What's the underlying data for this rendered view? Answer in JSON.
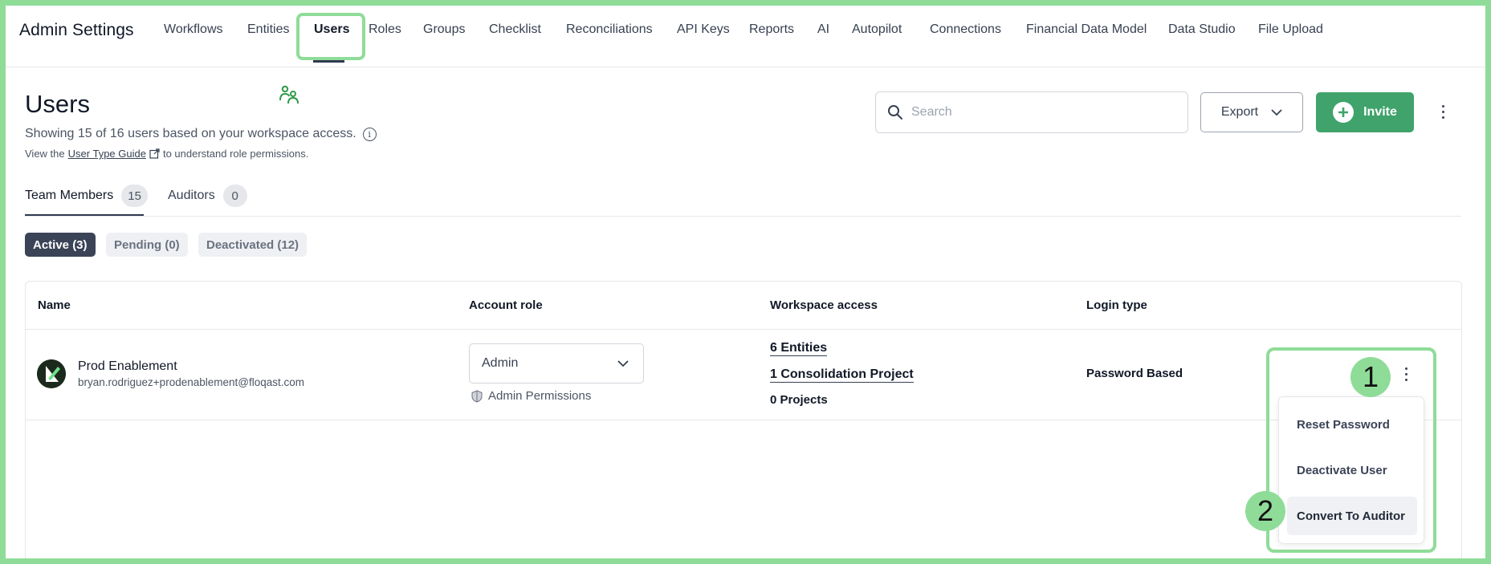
{
  "app": {
    "title": "Admin Settings"
  },
  "nav": {
    "tabs": [
      {
        "label": "Workflows"
      },
      {
        "label": "Entities"
      },
      {
        "label": "Users",
        "active": true
      },
      {
        "label": "Roles"
      },
      {
        "label": "Groups"
      },
      {
        "label": "Checklist"
      },
      {
        "label": "Reconciliations"
      },
      {
        "label": "API Keys"
      },
      {
        "label": "Reports"
      },
      {
        "label": "AI"
      },
      {
        "label": "Autopilot"
      },
      {
        "label": "Connections"
      },
      {
        "label": "Financial Data Model"
      },
      {
        "label": "Data Studio"
      },
      {
        "label": "File Upload"
      }
    ]
  },
  "header": {
    "title": "Users",
    "showing": "Showing 15 of 16 users based on your workspace access.",
    "guide_prefix": "View the",
    "guide_link": "User Type Guide",
    "guide_suffix": "to understand role permissions.",
    "search_placeholder": "Search",
    "export_label": "Export",
    "invite_label": "Invite"
  },
  "team_tabs": [
    {
      "label": "Team Members",
      "count": "15",
      "active": true
    },
    {
      "label": "Auditors",
      "count": "0"
    }
  ],
  "status_filters": [
    {
      "label": "Active (3)",
      "active": true
    },
    {
      "label": "Pending (0)"
    },
    {
      "label": "Deactivated (12)"
    }
  ],
  "table": {
    "columns": [
      "Name",
      "Account role",
      "Workspace access",
      "Login type"
    ],
    "rows": [
      {
        "name": "Prod Enablement",
        "email": "bryan.rodriguez+prodenablement@floqast.com",
        "role": "Admin",
        "permissions": "Admin Permissions",
        "entities": "6 Entities",
        "consolidation": "1 Consolidation Project",
        "projects": "0 Projects",
        "login_type": "Password Based"
      }
    ]
  },
  "row_menu": {
    "items": [
      "Reset Password",
      "Deactivate User",
      "Convert To Auditor"
    ]
  },
  "markers": [
    "1",
    "2"
  ],
  "colors": {
    "accent_green": "#3fa36b",
    "highlight_green": "#8fdc98",
    "active_pill": "#3b4357"
  }
}
